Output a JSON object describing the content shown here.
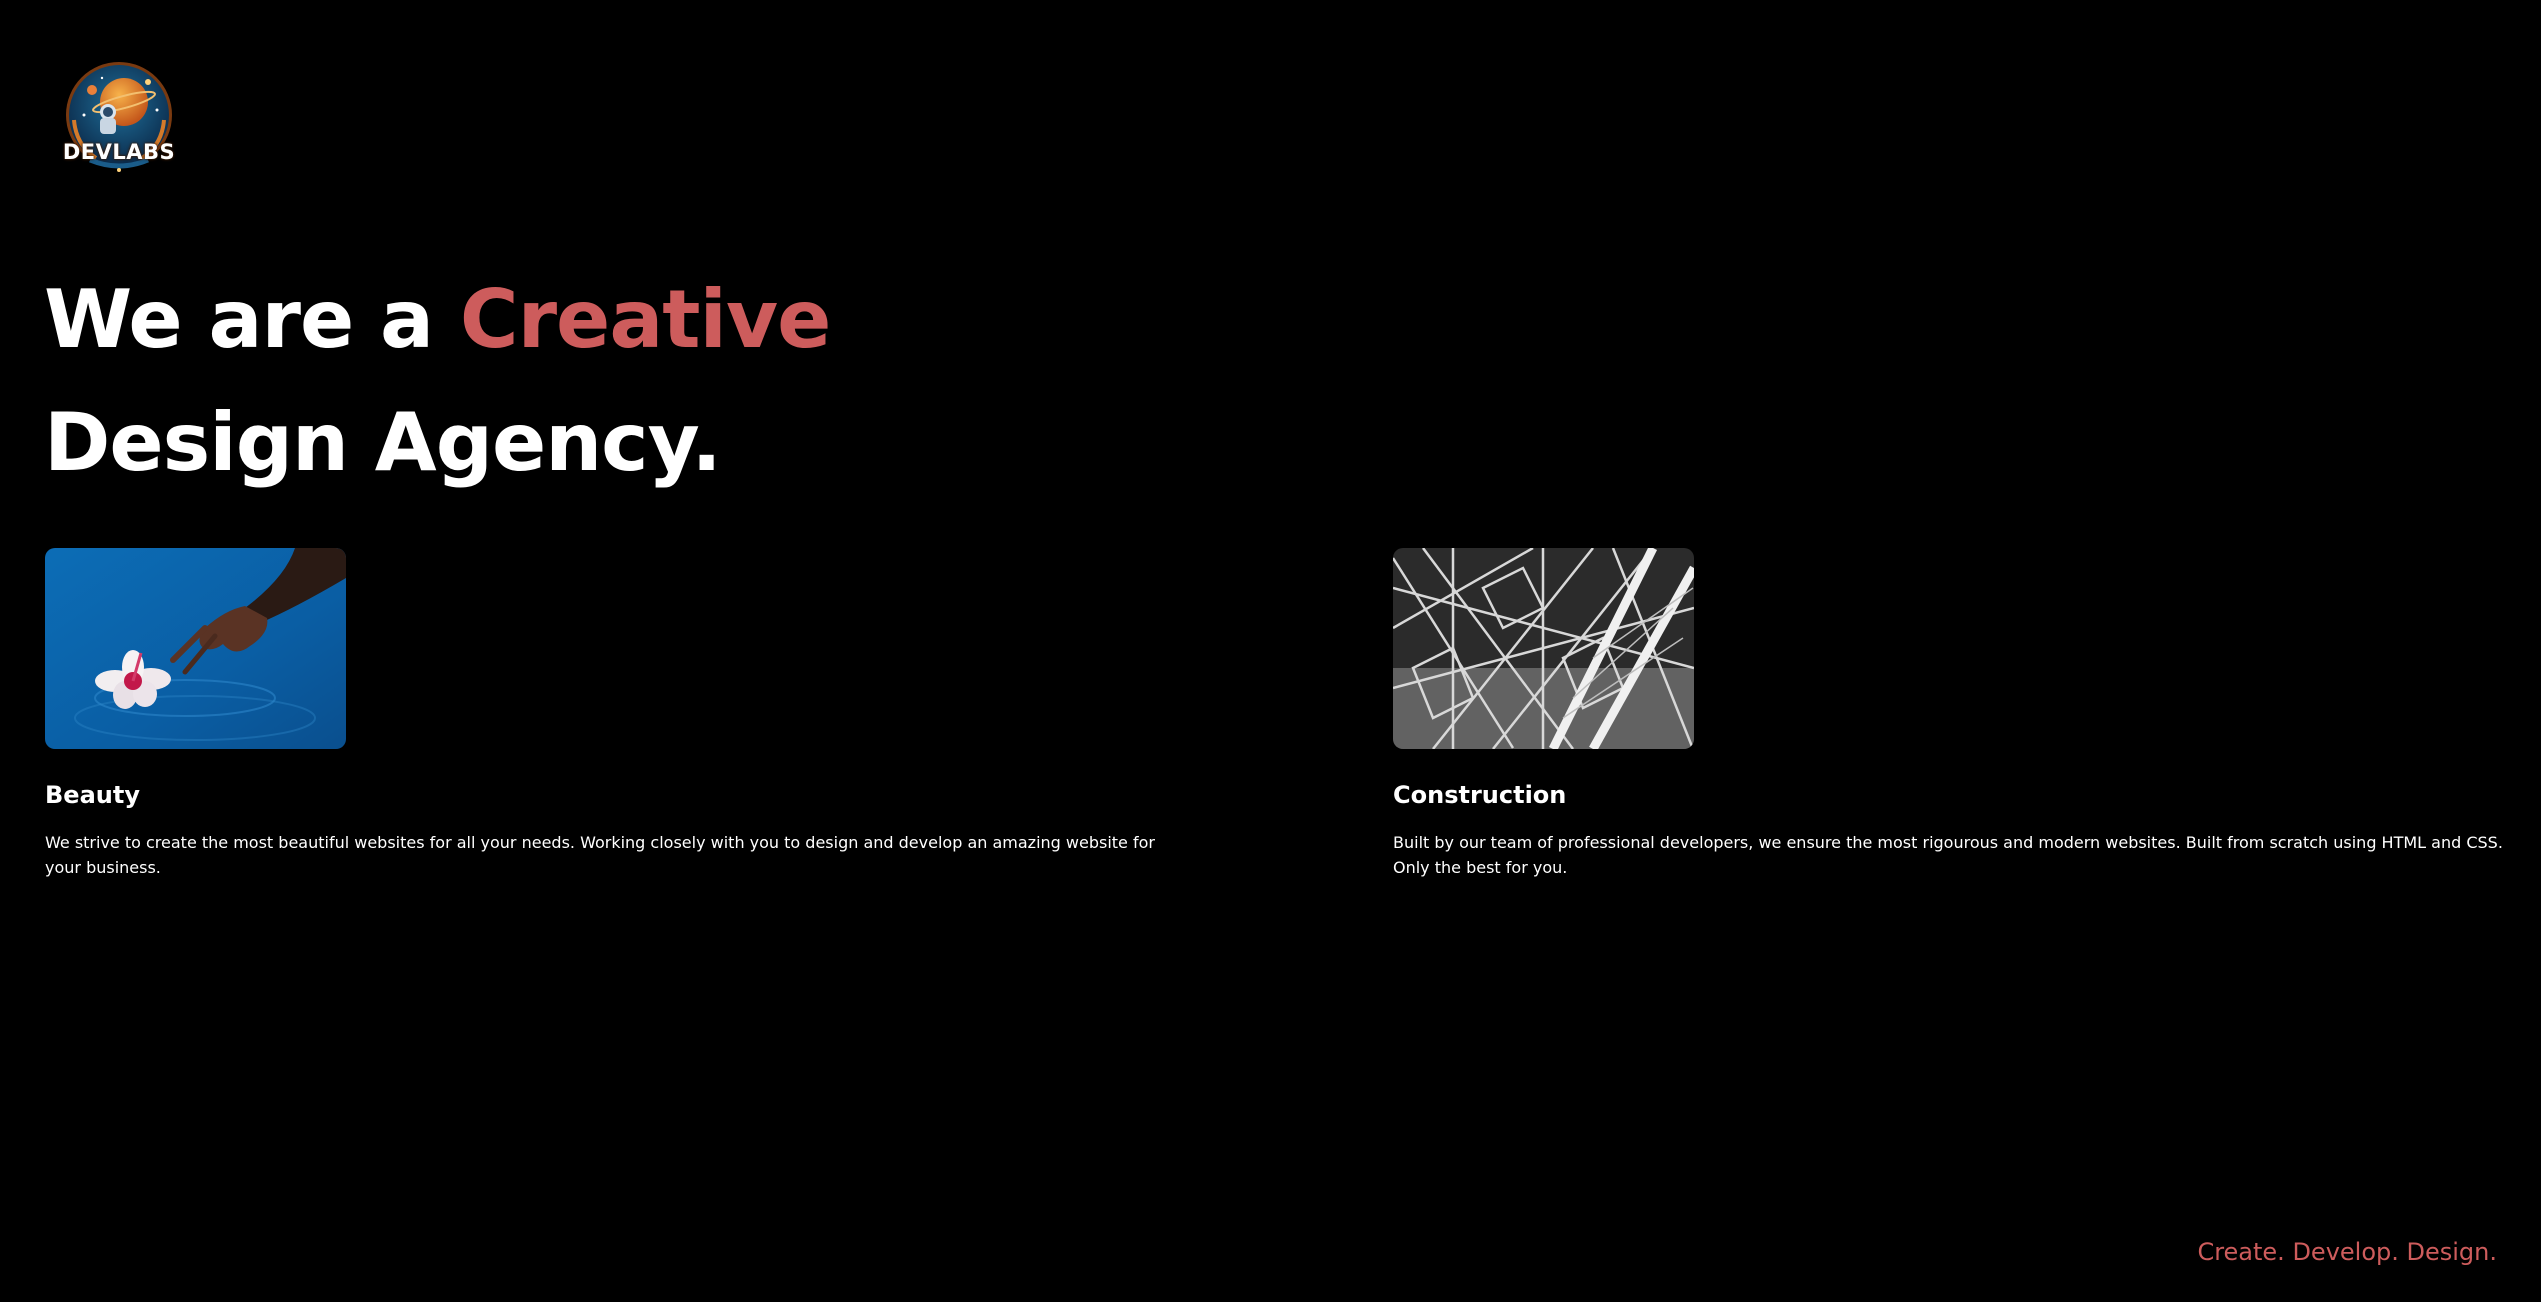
{
  "brand": {
    "logo_text": "DEVLABS"
  },
  "hero": {
    "line1_prefix": "We are a ",
    "line1_accent": "Creative",
    "line2": "Design Agency."
  },
  "colors": {
    "background": "#000000",
    "text": "#ffffff",
    "accent": "#cd5c5c"
  },
  "cards": [
    {
      "image": "hand-touching-flower-in-water-image",
      "title": "Beauty",
      "text": "We strive to create the most beautiful websites for all your needs. Working closely with you to design and develop an amazing website for your business."
    },
    {
      "image": "steel-truss-structure-image",
      "title": "Construction",
      "text": "Built by our team of professional developers, we ensure the most rigourous and modern websites. Built from scratch using HTML and CSS. Only the best for you."
    }
  ],
  "footer": {
    "tagline": "Create. Develop. Design."
  }
}
